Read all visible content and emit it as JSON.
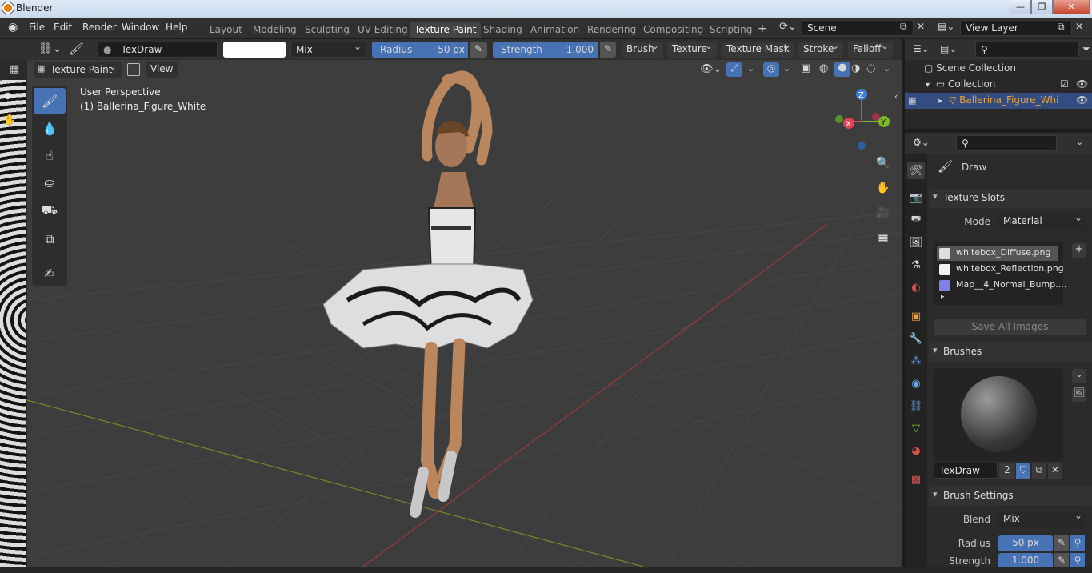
{
  "window": {
    "title": "Blender",
    "min": "—",
    "max": "❐",
    "close": "✕"
  },
  "menu": [
    "File",
    "Edit",
    "Render",
    "Window",
    "Help"
  ],
  "workspaces": [
    "Layout",
    "Modeling",
    "Sculpting",
    "UV Editing",
    "Texture Paint",
    "Shading",
    "Animation",
    "Rendering",
    "Compositing",
    "Scripting"
  ],
  "active_workspace": "Texture Paint",
  "add_workspace": "+",
  "scene": {
    "value": "Scene",
    "view_layer": "View Layer"
  },
  "toolheader": {
    "brush_name": "TexDraw",
    "blend": "Mix",
    "radius_label": "Radius",
    "radius_value": "50 px",
    "strength_label": "Strength",
    "strength_value": "1.000",
    "menus": [
      "Brush",
      "Texture",
      "Texture Mask",
      "Stroke",
      "Falloff"
    ]
  },
  "modeheader": {
    "mode": "Texture Paint",
    "view": "View"
  },
  "viewport": {
    "perspective": "User Perspective",
    "object": "(1) Ballerina_Figure_White"
  },
  "gizmo": {
    "x": "X",
    "y": "Y",
    "z": "Z"
  },
  "outliner": {
    "root": "Scene Collection",
    "collection": "Collection",
    "object": "Ballerina_Figure_Whi"
  },
  "properties": {
    "tool_name": "Draw",
    "texture_slots": {
      "title": "Texture Slots",
      "mode_label": "Mode",
      "mode_value": "Material",
      "slots": [
        "whitebox_Diffuse.png",
        "whitebox_Reflection.png",
        "Map__4_Normal_Bump...."
      ],
      "save_all": "Save All Images",
      "add": "+"
    },
    "brushes": {
      "title": "Brushes",
      "brush_name": "TexDraw",
      "users": "2"
    },
    "brush_settings": {
      "title": "Brush Settings",
      "blend_label": "Blend",
      "blend_value": "Mix",
      "radius_label": "Radius",
      "radius_value": "50 px",
      "strength_label": "Strength",
      "strength_value": "1.000"
    }
  },
  "colors": {
    "accent": "#4772b3",
    "active_object": "#e8a33d",
    "x_axis": "#e14153",
    "y_axis": "#7cbc2a",
    "z_axis": "#3c7fd6"
  }
}
